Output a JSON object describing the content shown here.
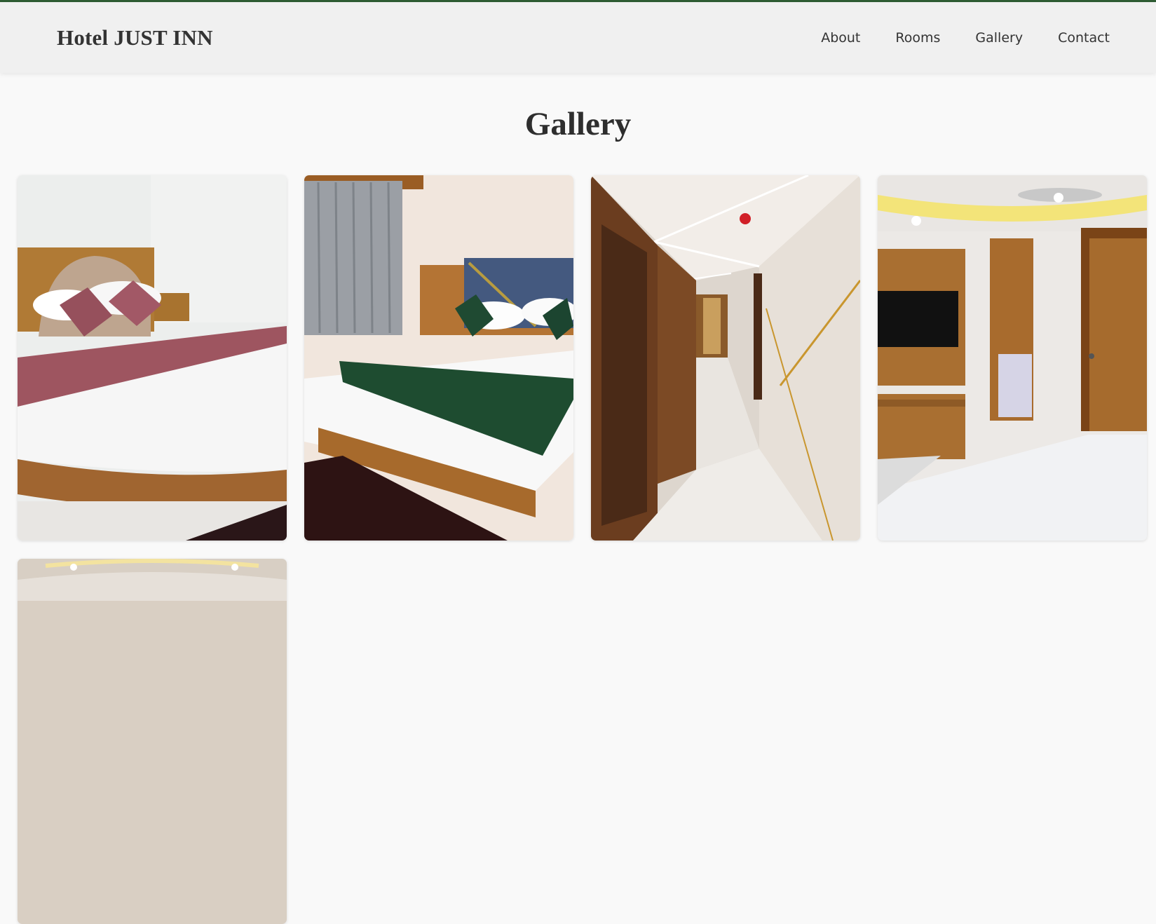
{
  "site": {
    "brand": "Hotel JUST INN",
    "accent_color": "#2f5d34"
  },
  "nav": {
    "items": [
      {
        "label": "About"
      },
      {
        "label": "Rooms"
      },
      {
        "label": "Gallery"
      },
      {
        "label": "Contact"
      }
    ]
  },
  "main": {
    "title": "Gallery",
    "images": [
      {
        "subject": "bedroom with round wooden bed and pink cushions"
      },
      {
        "subject": "bedroom with blue headboard and green runner"
      },
      {
        "subject": "hotel corridor with marble floor"
      },
      {
        "subject": "room with wall-mounted TV and wardrobe"
      },
      {
        "subject": "room with ceiling lights"
      }
    ]
  }
}
